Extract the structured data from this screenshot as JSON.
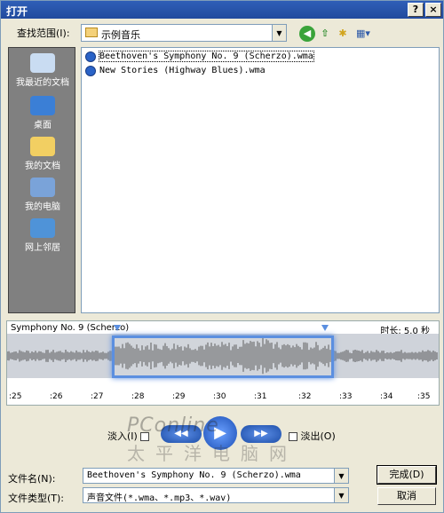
{
  "window": {
    "title": "打开",
    "help_label": "?",
    "close_label": "×"
  },
  "lookin": {
    "label": "查找范围(I):",
    "value": "示例音乐"
  },
  "toolbar": {
    "back_icon": "back-icon",
    "up_icon": "up-folder-icon",
    "new_folder_icon": "new-folder-icon",
    "views_icon": "views-icon"
  },
  "places": [
    {
      "label": "我最近的文档",
      "icon": "recent-docs-icon"
    },
    {
      "label": "桌面",
      "icon": "desktop-icon"
    },
    {
      "label": "我的文档",
      "icon": "my-documents-icon"
    },
    {
      "label": "我的电脑",
      "icon": "my-computer-icon"
    },
    {
      "label": "网上邻居",
      "icon": "network-icon"
    }
  ],
  "files": [
    {
      "name": "Beethoven's Symphony No. 9 (Scherzo).wma",
      "selected": true
    },
    {
      "name": "New Stories (Highway Blues).wma",
      "selected": false
    }
  ],
  "preview": {
    "clip_name": "Symphony No. 9 (Scherzo)",
    "duration": "时长: 5.0 秒",
    "timeline": [
      ":25",
      ":26",
      ":27",
      ":28",
      ":29",
      ":30",
      ":31",
      ":32",
      ":33",
      ":34",
      ":35"
    ]
  },
  "controls": {
    "fade_in": "淡入(I)",
    "fade_out": "淡出(O)"
  },
  "watermark": {
    "line1": "PConline",
    "line2": "太平洋电脑网"
  },
  "filename": {
    "label": "文件名(N):",
    "value": "Beethoven's Symphony No. 9 (Scherzo).wma"
  },
  "filetype": {
    "label": "文件类型(T):",
    "value": "声音文件(*.wma、*.mp3、*.wav)"
  },
  "buttons": {
    "done": "完成(D)",
    "cancel": "取消"
  },
  "colors": {
    "titlebar": "#2f5fb8",
    "selection": "#5b8fe0",
    "places_bg": "#808080"
  }
}
